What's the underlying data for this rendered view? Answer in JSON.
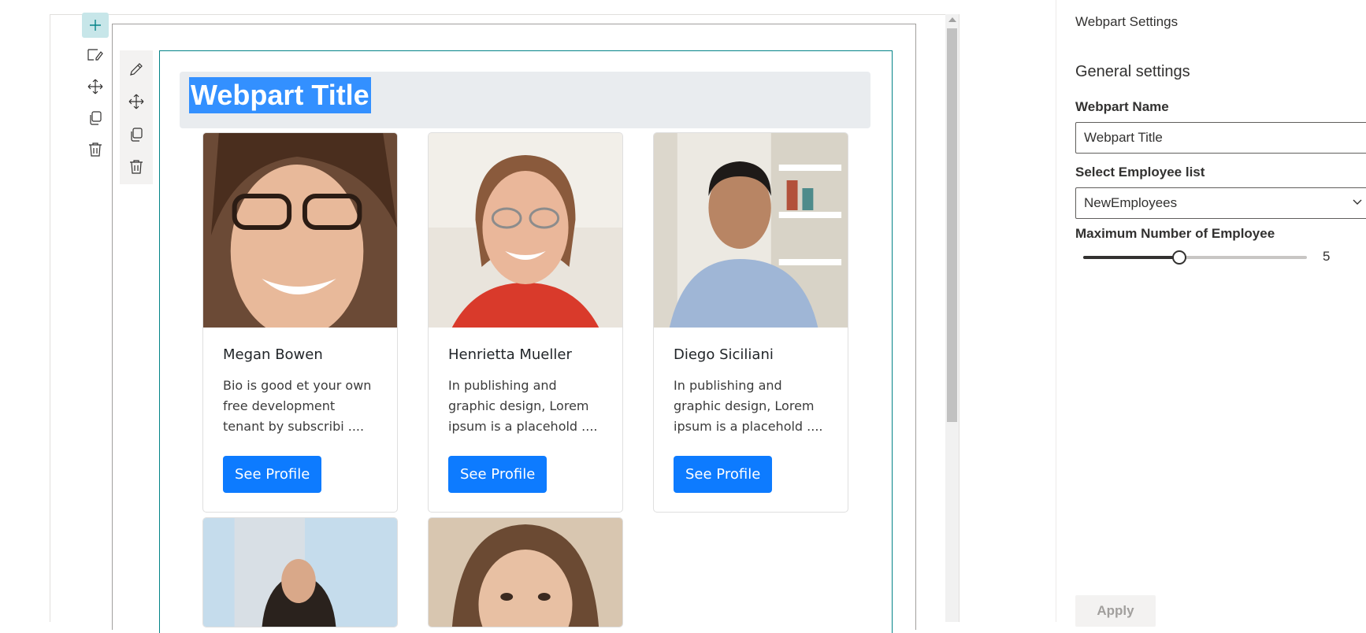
{
  "section_toolbar": {
    "icons": [
      "add-icon",
      "edit-section-icon",
      "move-icon",
      "duplicate-icon",
      "delete-icon"
    ]
  },
  "webpart_toolbar": {
    "icons": [
      "pencil-icon",
      "move-icon",
      "duplicate-icon",
      "delete-icon"
    ]
  },
  "webpart": {
    "title": "Webpart Title",
    "employees": [
      {
        "name": "Megan Bowen",
        "bio": "Bio is good et your own free development tenant by subscribi ....",
        "button_label": "See Profile"
      },
      {
        "name": "Henrietta Mueller",
        "bio": "In publishing and graphic design, Lorem ipsum is a placehold ....",
        "button_label": "See Profile"
      },
      {
        "name": "Diego Siciliani",
        "bio": "In publishing and graphic design, Lorem ipsum is a placehold ....",
        "button_label": "See Profile"
      }
    ]
  },
  "panel": {
    "header": "Webpart Settings",
    "group_title": "General settings",
    "name_label": "Webpart Name",
    "name_value": "Webpart Title",
    "list_label": "Select Employee list",
    "list_value": "NewEmployees",
    "max_label": "Maximum Number of Employee",
    "max_value": "5",
    "max_fraction": 0.43,
    "apply_label": "Apply"
  },
  "colors": {
    "accent_teal": "#038387",
    "button_blue": "#0d7bff",
    "selection_blue": "#3390ff"
  }
}
